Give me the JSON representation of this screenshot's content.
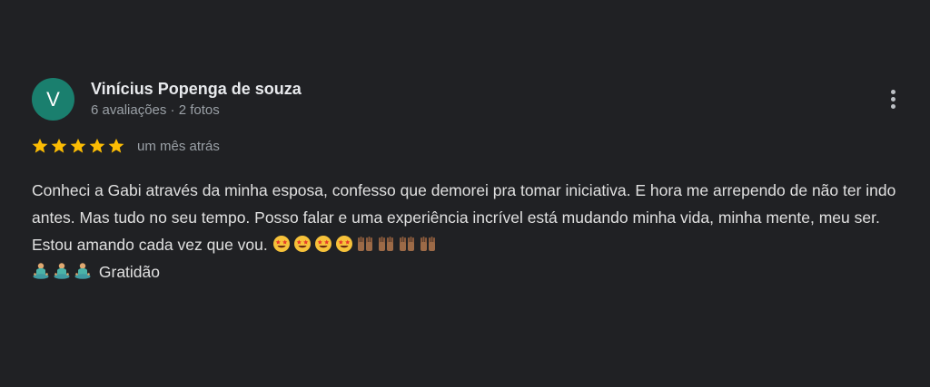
{
  "review": {
    "avatar_letter": "V",
    "author": "Vinícius Popenga de souza",
    "author_meta": "6 avaliações · 2 fotos",
    "rating": 5,
    "rating_max": 5,
    "time_ago": "um mês atrás",
    "text": "Conheci a Gabi através da minha esposa, confesso que demorei pra tomar iniciativa. E hora me arrependo de não ter indo antes. Mas tudo no seu tempo. Posso falar e uma experiência incrível está mudando minha vida, minha mente, meu ser. Estou amando cada vez que vou.",
    "closing_word": "Gratidão"
  },
  "emojis": {
    "star_struck": "star-struck-face-icon",
    "raising_hands": "raising-hands-icon",
    "meditation": "person-meditating-icon"
  },
  "colors": {
    "background": "#202124",
    "avatar": "#1a7f6e",
    "star": "#fbbc04",
    "name": "#e8eaed",
    "secondary_text": "#9aa0a6",
    "body_text": "#e0e0e0"
  }
}
